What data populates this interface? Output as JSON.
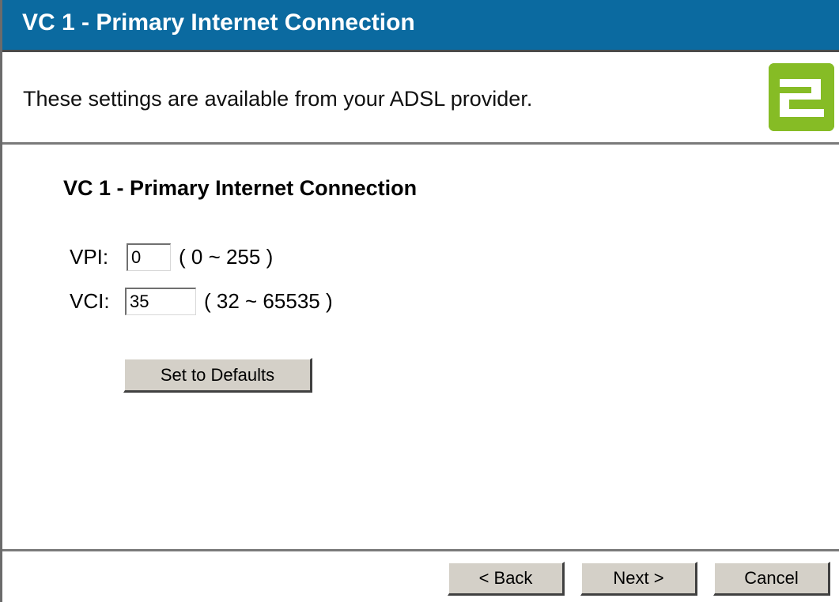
{
  "header": {
    "title": "VC 1 - Primary Internet Connection"
  },
  "info": {
    "text": "These settings are available from your ADSL provider.",
    "logo_icon": "brand-logo-icon",
    "logo_color": "#86bc25"
  },
  "main": {
    "section_title": "VC 1 - Primary Internet Connection",
    "vpi": {
      "label": "VPI:",
      "value": "0",
      "range": "( 0 ~ 255 )"
    },
    "vci": {
      "label": "VCI:",
      "value": "35",
      "range": "( 32 ~ 65535 )"
    },
    "defaults_button": "Set to Defaults"
  },
  "footer": {
    "back_label": "< Back",
    "next_label": "Next >",
    "cancel_label": "Cancel"
  },
  "colors": {
    "title_bar": "#0b6aa0",
    "button_face": "#d4d0c8"
  }
}
